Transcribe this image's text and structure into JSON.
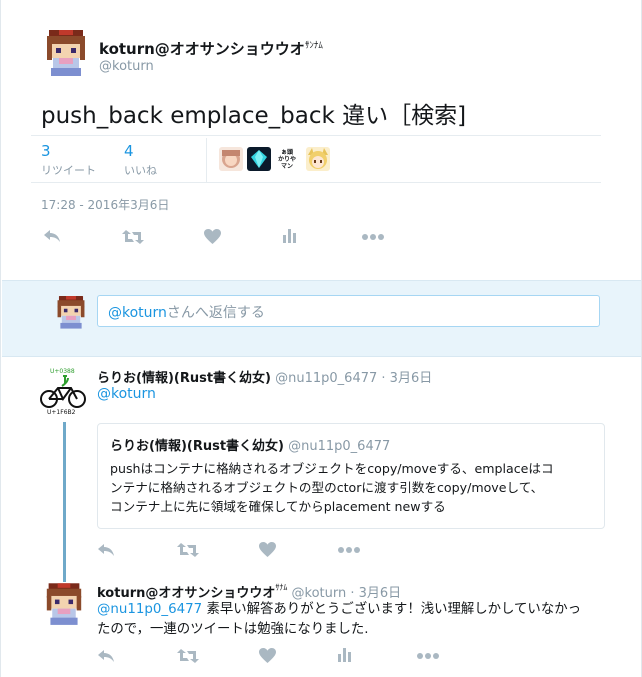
{
  "main_tweet": {
    "display_name": "koturn@オオサンショウウオ",
    "name_suffix": "ｻﾝﾅﾑ",
    "handle": "@koturn",
    "text": "push_back emplace_back 違い［検索]",
    "retweets": {
      "count": "3",
      "label": "リツイート"
    },
    "likes": {
      "count": "4",
      "label": "いいね"
    },
    "timestamp": "17:28 - 2016年3月6日",
    "liker_avatars": [
      "avatar-girl",
      "avatar-gem",
      "avatar-text",
      "avatar-blonde"
    ],
    "liker_text_avatar_lines": [
      "ぁ頭",
      "かりや",
      "マン"
    ]
  },
  "reply_box": {
    "mention": "@koturn",
    "placeholder_suffix": "さんへ返信する"
  },
  "reply_1": {
    "display_name": "らりお(情報)(Rust書く幼女)",
    "handle": "@nu11p0_6477",
    "date": "· 3月6日",
    "mention": "@koturn",
    "avatar_top_label": "U+0388",
    "avatar_bottom_label": "U+1F6B2",
    "quote": {
      "display_name": "らりお(情報)(Rust書く幼女)",
      "handle": "@nu11p0_6477",
      "lines": [
        "pushはコンテナに格納されるオブジェクトをcopy/moveする、emplaceはコ",
        "ンテナに格納されるオブジェクトの型のctorに渡す引数をcopy/moveして、",
        "コンテナ上に先に領域を確保してからplacement newする"
      ]
    }
  },
  "reply_2": {
    "display_name": "koturn@オオサンショウウオ",
    "name_suffix": "ｻﾅﾑ",
    "handle": "@koturn",
    "date": "· 3月6日",
    "mention": "@nu11p0_6477",
    "text_line1": " 素早い解答ありがとうございます！浅い理解しかしていなかっ",
    "text_line2": "たので，一連のツイートは勉強になりました."
  },
  "actions": [
    "reply-icon",
    "retweet-icon",
    "like-icon",
    "analytics-icon",
    "more-icon"
  ],
  "colors": {
    "link": "#1b95e0",
    "muted": "#8899a6",
    "icon": "#aab8c2",
    "reply_band": "#e8f4fb",
    "thread_line": "#6fa9c9"
  }
}
